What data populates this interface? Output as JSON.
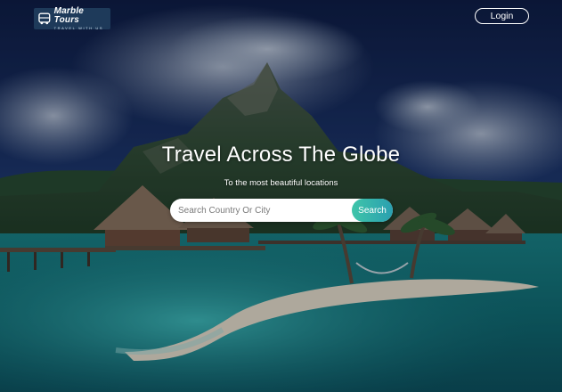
{
  "header": {
    "logo": {
      "title": "Marble Tours",
      "subtitle": "TRAVEL WITH US",
      "icon": "bus-icon",
      "background_color": "#1e3a5a"
    },
    "login_label": "Login"
  },
  "hero": {
    "headline": "Travel Across The Globe",
    "subheadline": "To the most beautiful locations",
    "background": "tropical-island-overwater-bungalows-photo"
  },
  "search": {
    "placeholder": "Search Country Or City",
    "value": "",
    "button_label": "Search",
    "accent_color": "#33b3ad"
  }
}
